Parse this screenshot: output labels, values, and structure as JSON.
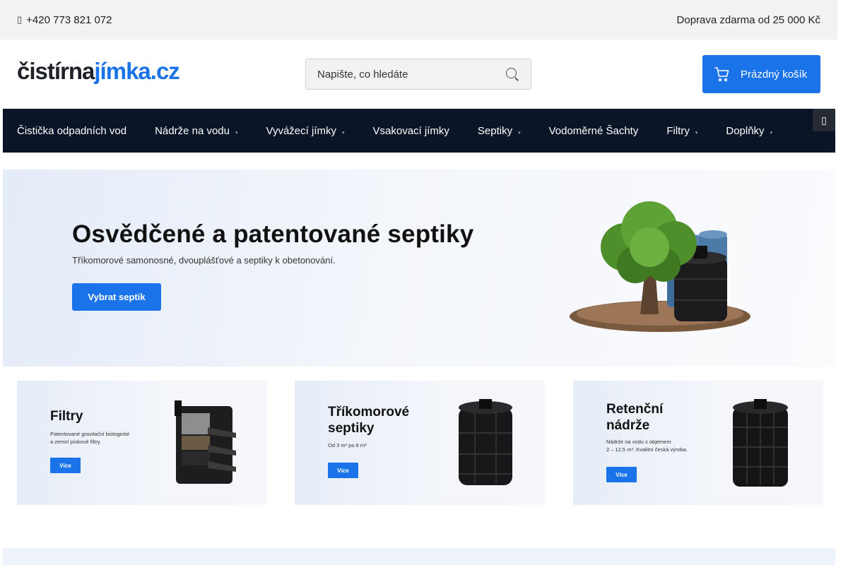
{
  "topbar": {
    "phone": "+420 773 821 072",
    "shipping": "Doprava zdarma od 25 000 Kč"
  },
  "header": {
    "logo_part1": "čistírna",
    "logo_part2": "jímka.cz",
    "search_placeholder": "Napište, co hledáte",
    "cart_label": "Prázdný košík"
  },
  "nav": {
    "items": [
      {
        "label": "Čistička odpadních vod",
        "has_dropdown": false
      },
      {
        "label": "Nádrže na vodu",
        "has_dropdown": true
      },
      {
        "label": "Vyvážecí jímky",
        "has_dropdown": true
      },
      {
        "label": "Vsakovací jímky",
        "has_dropdown": false
      },
      {
        "label": "Septiky",
        "has_dropdown": true
      },
      {
        "label": "Vodoměrné Šachty",
        "has_dropdown": false
      },
      {
        "label": "Filtry",
        "has_dropdown": true
      },
      {
        "label": "Doplňky",
        "has_dropdown": true
      }
    ]
  },
  "hero": {
    "title": "Osvědčené a patentované septiky",
    "subtitle": "Tříkomorové samonosné, dvouplášťové a septiky k obetonování.",
    "button": "Vybrat septik"
  },
  "tiles": [
    {
      "title_line1": "Filtry",
      "title_line2": "",
      "desc_line1": "Patentované gravitační biologické",
      "desc_line2": "a zemní pískové filtry.",
      "button": "Více"
    },
    {
      "title_line1": "Tříkomorové",
      "title_line2": "septiky",
      "desc_line1": "Od 3 m³ po 8 m³",
      "desc_line2": "",
      "button": "Více"
    },
    {
      "title_line1": "Retenční",
      "title_line2": "nádrže",
      "desc_line1": "Nádrže na vodu s objemem",
      "desc_line2": "2 – 12,5 m³. Kvalitní česká výroba.",
      "button": "Více"
    }
  ],
  "colors": {
    "accent": "#1a73e8",
    "nav_bg": "#0a1628",
    "topbar_bg": "#f2f2f4"
  }
}
